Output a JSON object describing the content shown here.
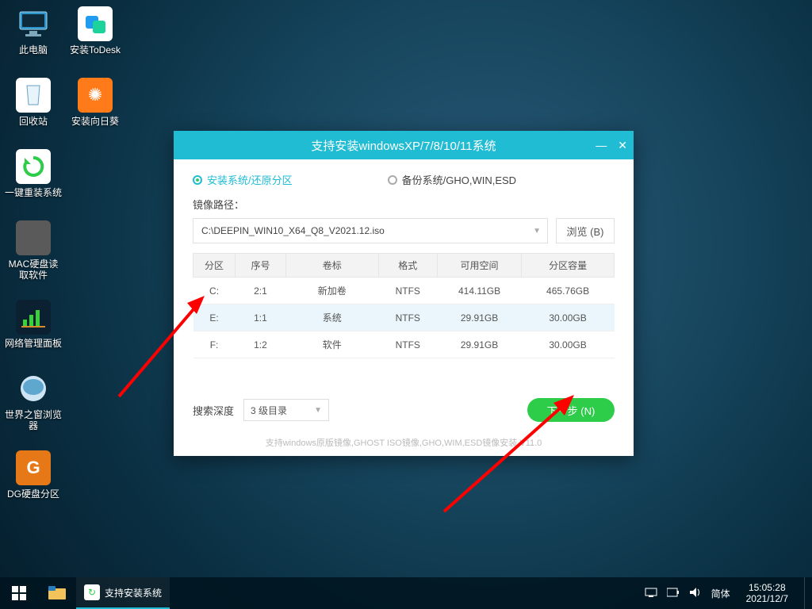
{
  "desktop_icons": [
    {
      "label": "此电脑"
    },
    {
      "label": "安装ToDesk"
    },
    {
      "label": "回收站"
    },
    {
      "label": "安装向日葵"
    },
    {
      "label": "一键重装系统"
    },
    {
      "label": "MAC硬盘读\n取软件"
    },
    {
      "label": "网络管理面板"
    },
    {
      "label": "世界之窗浏览\n器"
    },
    {
      "label": "DG硬盘分区"
    }
  ],
  "window": {
    "title": "支持安装windowsXP/7/8/10/11系统",
    "mode_install": "安装系统/还原分区",
    "mode_backup": "备份系统/GHO,WIN,ESD",
    "mirror_label": "镜像路径：",
    "path": "C:\\DEEPIN_WIN10_X64_Q8_V2021.12.iso",
    "browse": "浏览 (B)",
    "headers": {
      "part": "分区",
      "seq": "序号",
      "vol": "卷标",
      "fmt": "格式",
      "free": "可用空间",
      "total": "分区容量"
    },
    "rows": [
      {
        "part": "C:",
        "seq": "2:1",
        "vol": "新加卷",
        "fmt": "NTFS",
        "free": "414.11GB",
        "total": "465.76GB"
      },
      {
        "part": "E:",
        "seq": "1:1",
        "vol": "系统",
        "fmt": "NTFS",
        "free": "29.91GB",
        "total": "30.00GB"
      },
      {
        "part": "F:",
        "seq": "1:2",
        "vol": "软件",
        "fmt": "NTFS",
        "free": "29.91GB",
        "total": "30.00GB"
      }
    ],
    "search_label": "搜索深度",
    "depth_value": "3 级目录",
    "next": "下一步 (N)",
    "footer": "支持windows原版镜像,GHOST ISO镜像,GHO,WIM,ESD镜像安装 V11.0"
  },
  "taskbar": {
    "task_label": "支持安装系统",
    "ime": "简体",
    "time": "15:05:28",
    "date": "2021/12/7"
  }
}
